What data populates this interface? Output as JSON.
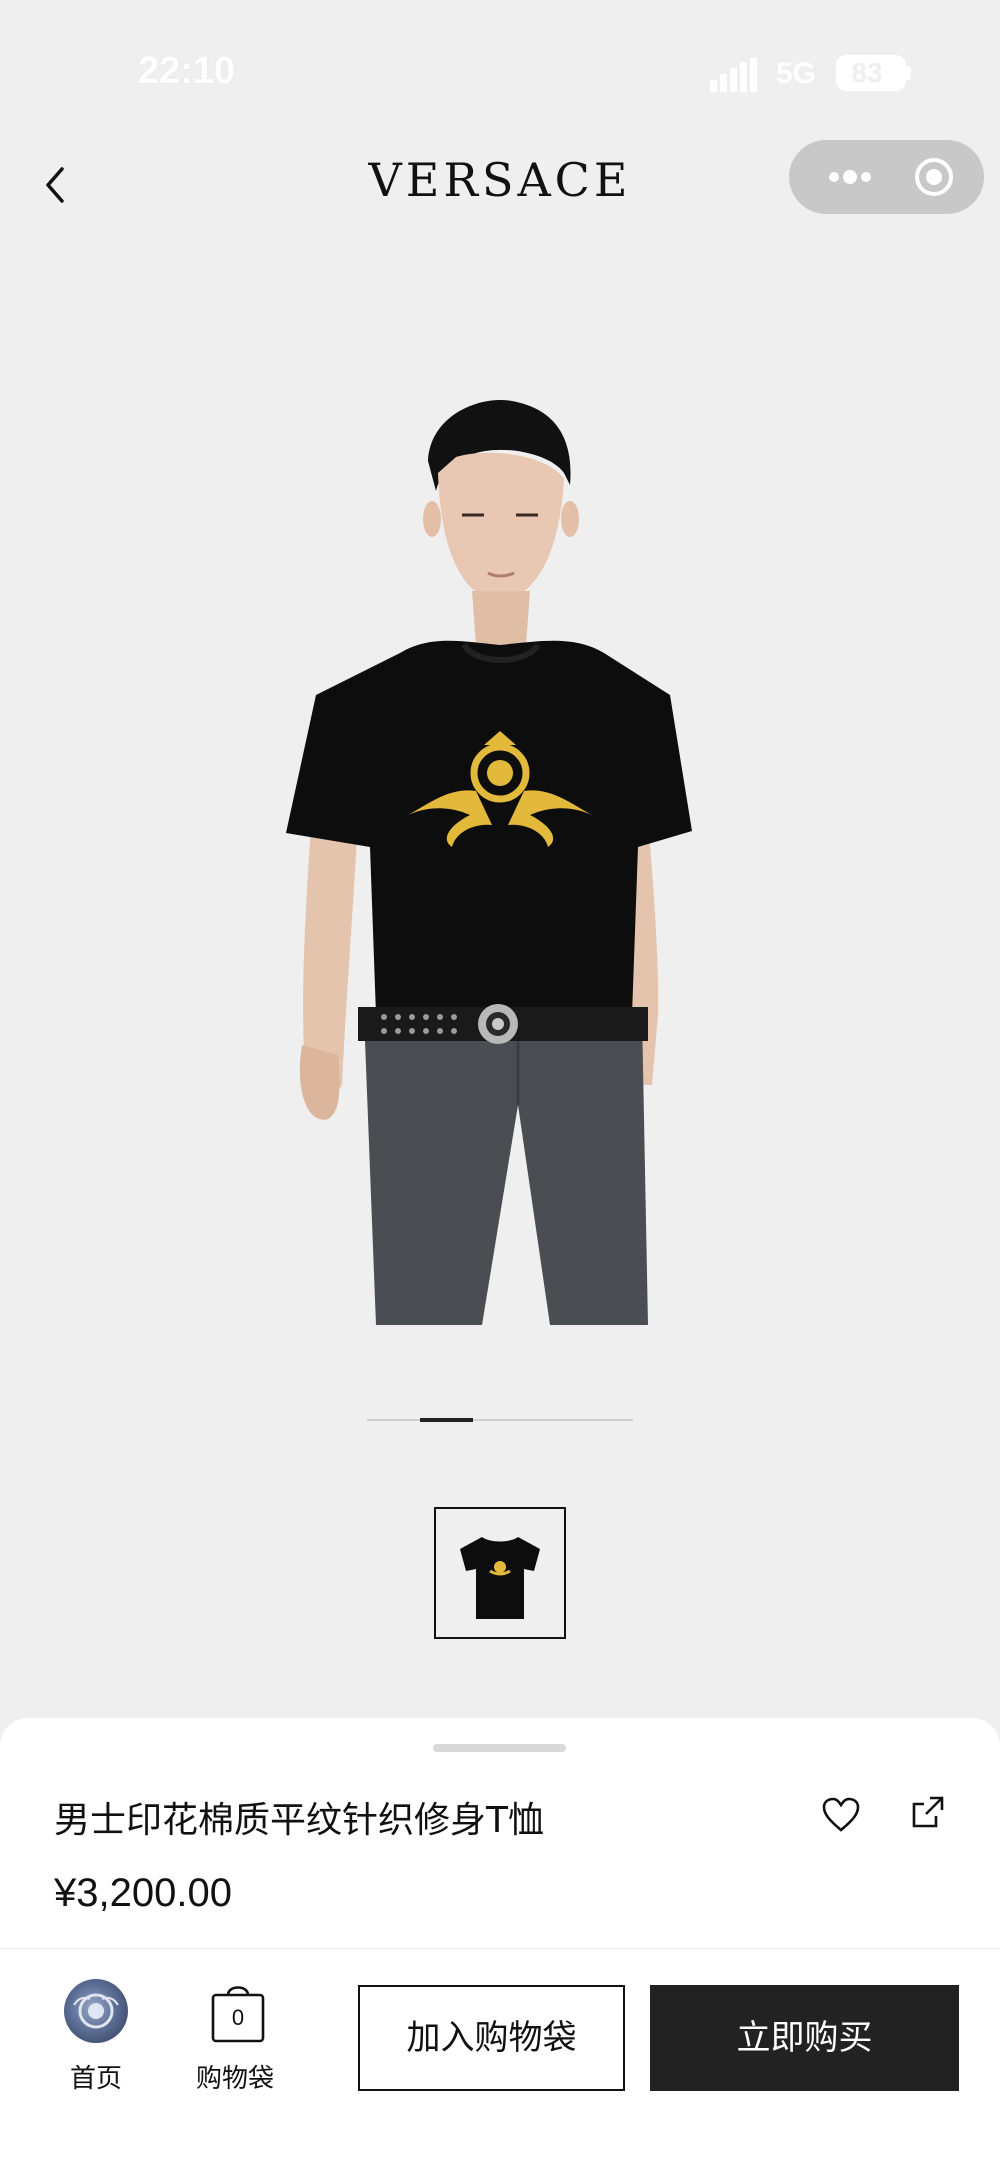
{
  "status_bar": {
    "time": "22:10",
    "network": "5G",
    "battery": "83"
  },
  "header": {
    "brand": "VERSACE",
    "icons": {
      "back": "back-arrow-icon",
      "more": "more-dots-icon",
      "close": "close-miniprogram-icon"
    }
  },
  "gallery": {
    "current_slide": 2,
    "total_slides": 5,
    "thumbnail": "tshirt-thumbnail"
  },
  "product": {
    "title": "男士印花棉质平纹针织修身T恤",
    "price": "¥3,200.00"
  },
  "bottom_nav": {
    "home_label": "首页",
    "bag_label": "购物袋",
    "bag_count": "0",
    "add_to_bag": "加入购物袋",
    "buy_now": "立即购买"
  },
  "colors": {
    "background": "#efefef",
    "primary_button": "#222222",
    "capsule": "#c8c8c8",
    "print_gold": "#e2b93b"
  }
}
